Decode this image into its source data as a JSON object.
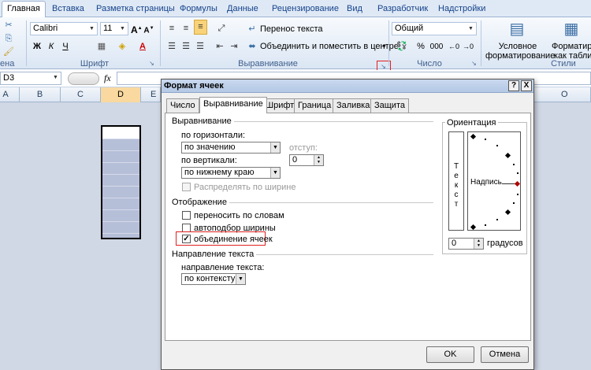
{
  "ribbon": {
    "tabs": [
      "Главная",
      "Вставка",
      "Разметка страницы",
      "Формулы",
      "Данные",
      "Рецензирование",
      "Вид",
      "Разработчик",
      "Надстройки"
    ],
    "clipboard_label": "ена",
    "font": {
      "name": "Calibri",
      "size": "11",
      "group_label": "Шрифт"
    },
    "alignment": {
      "wrap_text": "Перенос текста",
      "merge_center": "Объединить и поместить в центре",
      "group_label": "Выравнивание"
    },
    "number": {
      "format": "Общий",
      "percent": "%",
      "thousands": "000",
      "group_label": "Число"
    },
    "styles": {
      "conditional_line1": "Условное",
      "conditional_line2": "форматирование",
      "format_table_line1": "Форматир",
      "format_table_line2": "как таблиц",
      "group_label": "Стили"
    }
  },
  "formula_bar": {
    "cell_ref": "D3",
    "fx": "fx"
  },
  "grid": {
    "columns": [
      "A",
      "B",
      "C",
      "D",
      "E"
    ],
    "selected_column": "D",
    "right_column": "O"
  },
  "dialog": {
    "title": "Формат ячеек",
    "help": "?",
    "close": "X",
    "tabs": [
      "Число",
      "Выравнивание",
      "Шрифт",
      "Граница",
      "Заливка",
      "Защита"
    ],
    "active_tab": "Выравнивание",
    "alignment_section": "Выравнивание",
    "horizontal_label": "по горизонтали:",
    "horizontal_value": "по значению",
    "indent_label": "отступ:",
    "indent_value": "0",
    "vertical_label": "по вертикали:",
    "vertical_value": "по нижнему краю",
    "distribute_label": "Распределять по ширине",
    "display_section": "Отображение",
    "wrap_label": "переносить по словам",
    "autofit_label": "автоподбор ширины",
    "merge_label": "объединение ячеек",
    "merge_checked": true,
    "direction_section": "Направление текста",
    "direction_label": "направление текста:",
    "direction_value": "по контексту",
    "orientation_section": "Ориентация",
    "vertical_text": [
      "Т",
      "е",
      "к",
      "с",
      "т"
    ],
    "dial_label": "Надпись",
    "degrees_value": "0",
    "degrees_label": "градусов",
    "ok": "OK",
    "cancel": "Отмена"
  },
  "colors": {
    "highlight_red": "#e02020",
    "selected_fill": "#b6bfd8",
    "tab_text": "#15428b"
  }
}
